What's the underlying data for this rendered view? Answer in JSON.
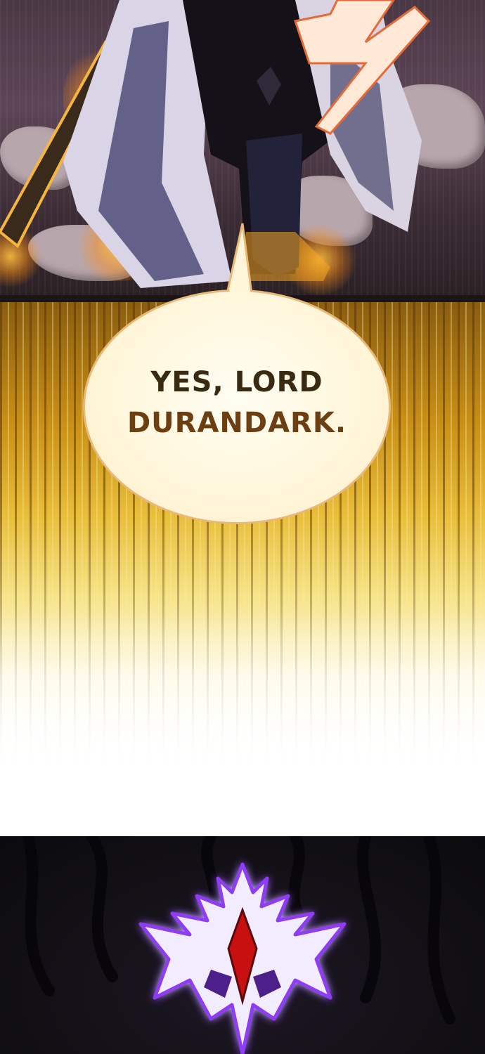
{
  "speech_bubble": {
    "line1": "YES, LORD",
    "line2": "DURANDARK."
  },
  "colors": {
    "bubble_fill": "#fff6da",
    "bubble_border": "#e8b978",
    "text_dark": "#3b2a12",
    "text_brown": "#6b3f12",
    "gold": "#e9be3a",
    "mask_white": "#f1ecff",
    "mask_glow": "#8e3df2",
    "gem_red": "#c81010"
  }
}
